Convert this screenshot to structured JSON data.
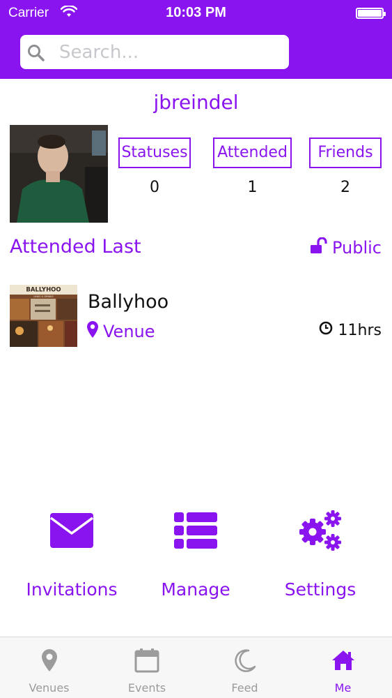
{
  "status_bar": {
    "carrier": "Carrier",
    "time": "10:03 PM"
  },
  "search": {
    "placeholder": "Search..."
  },
  "profile": {
    "username": "jbreindel",
    "stats": [
      {
        "label": "Statuses",
        "value": "0"
      },
      {
        "label": "Attended",
        "value": "1"
      },
      {
        "label": "Friends",
        "value": "2"
      }
    ]
  },
  "attended": {
    "title": "Attended Last",
    "privacy": "Public",
    "venue": {
      "name": "Ballyhoo",
      "type": "Venue",
      "time_ago": "11hrs",
      "thumb_text": "BALLYHOO",
      "thumb_subtext": "LINKS & DRINKS"
    }
  },
  "actions": [
    {
      "label": "Invitations",
      "icon": "envelope-icon"
    },
    {
      "label": "Manage",
      "icon": "list-icon"
    },
    {
      "label": "Settings",
      "icon": "gears-icon"
    }
  ],
  "tabbar": [
    {
      "label": "Venues",
      "icon": "map-marker-icon",
      "active": false
    },
    {
      "label": "Events",
      "icon": "calendar-icon",
      "active": false
    },
    {
      "label": "Feed",
      "icon": "moon-icon",
      "active": false
    },
    {
      "label": "Me",
      "icon": "home-icon",
      "active": true
    }
  ],
  "colors": {
    "accent": "#8a14f0",
    "tab_inactive": "#9b9b9b",
    "tab_background": "#f7f7f7"
  }
}
